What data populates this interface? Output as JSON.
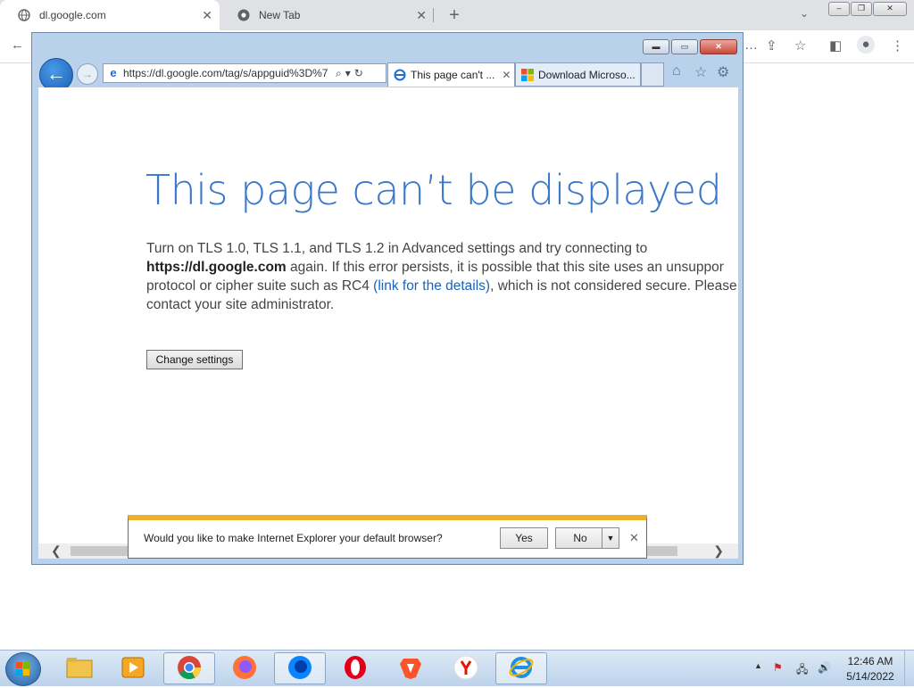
{
  "chrome": {
    "tabs": [
      {
        "label": "dl.google.com"
      },
      {
        "label": "New Tab"
      }
    ],
    "new_tab_label": "+"
  },
  "ie": {
    "address": "https://dl.google.com/tag/s/appguid%3D%7",
    "tabs": [
      {
        "label": "This page can't ..."
      },
      {
        "label": "Download Microso..."
      }
    ],
    "error": {
      "title": "This page can’t be displayed",
      "line1": "Turn on TLS 1.0, TLS 1.1, and TLS 1.2 in Advanced settings and try connecting to",
      "host": "https://dl.google.com",
      "line2": " again. If this error persists, it is possible that this site uses an unsuppor",
      "line3a": "protocol or cipher suite such as RC4 ",
      "link": "(link for the details)",
      "line3b": ", which is not considered secure. Please",
      "line4": "contact your site administrator.",
      "button": "Change settings"
    },
    "notification": {
      "text": "Would you like to make Internet Explorer your default browser?",
      "yes": "Yes",
      "no": "No"
    }
  },
  "taskbar": {
    "apps": [
      "file-explorer",
      "media-player",
      "chrome",
      "firefox",
      "firefox-dev",
      "opera",
      "brave",
      "yandex",
      "internet-explorer"
    ],
    "time": "12:46 AM",
    "date": "5/14/2022"
  },
  "colors": {
    "ie_title_blue": "#3a77c8",
    "notification_accent": "#e8b22a",
    "link": "#1a63b8"
  }
}
